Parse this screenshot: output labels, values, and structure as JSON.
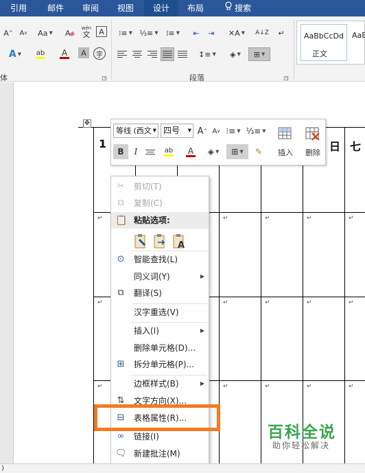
{
  "tabs": [
    "引用",
    "邮件",
    "审阅",
    "视图",
    "设计",
    "布局",
    "搜索"
  ],
  "active_tab": "设计",
  "ribbon": {
    "font_group_label": "体",
    "paragraph_group_label": "段落",
    "font_size_grow": "A",
    "font_size_shrink": "A",
    "change_case": "Aa",
    "phonetic_guide": "wén",
    "phonetic_guide_char": "文",
    "enclose": "A",
    "char_border": "A",
    "circle_char": "字",
    "font_color": "A",
    "sort": "A↓Z",
    "show_marks": "↵",
    "style_preview": "AaBbCcDd",
    "style_name": "正文",
    "style_preview_2": "AaB"
  },
  "table": {
    "header_cells": [
      "1",
      "",
      "",
      "",
      "",
      "",
      "日",
      "七"
    ],
    "paragraph_mark": "↵"
  },
  "mini_toolbar": {
    "font_name": "等线 (西文",
    "font_size": "四号",
    "bold": "B",
    "italic": "I",
    "grow_font": "A",
    "shrink_font": "A",
    "insert_label": "插入",
    "delete_label": "删除",
    "highlight_label": "ab",
    "font_color": "A"
  },
  "context_menu": {
    "cut": "剪切(T)",
    "copy": "复制(C)",
    "paste_options": "粘贴选项:",
    "smart_lookup": "智能查找(L)",
    "synonyms": "同义词(Y)",
    "translate": "翻译(S)",
    "hanzi_reselect": "汉字重选(V)",
    "insert": "插入(I)",
    "delete_cells": "删除单元格(D)...",
    "split_cells": "拆分单元格(P)...",
    "border_styles": "边框样式(B)",
    "text_direction": "文字方向(X)...",
    "table_properties": "表格属性(R)...",
    "link": "链接(I)",
    "new_comment": "新建批注(M)"
  },
  "status_bar": {
    "text": ")"
  },
  "watermark": {
    "main": "百科全说",
    "sub": "助你轻松解决"
  },
  "colors": {
    "ribbon_blue": "#2b579a",
    "highlight_orange": "#f47b20",
    "watermark_green": "#3aa551",
    "font_color_red": "#c00000",
    "highlighter_yellow": "#ffff00"
  }
}
